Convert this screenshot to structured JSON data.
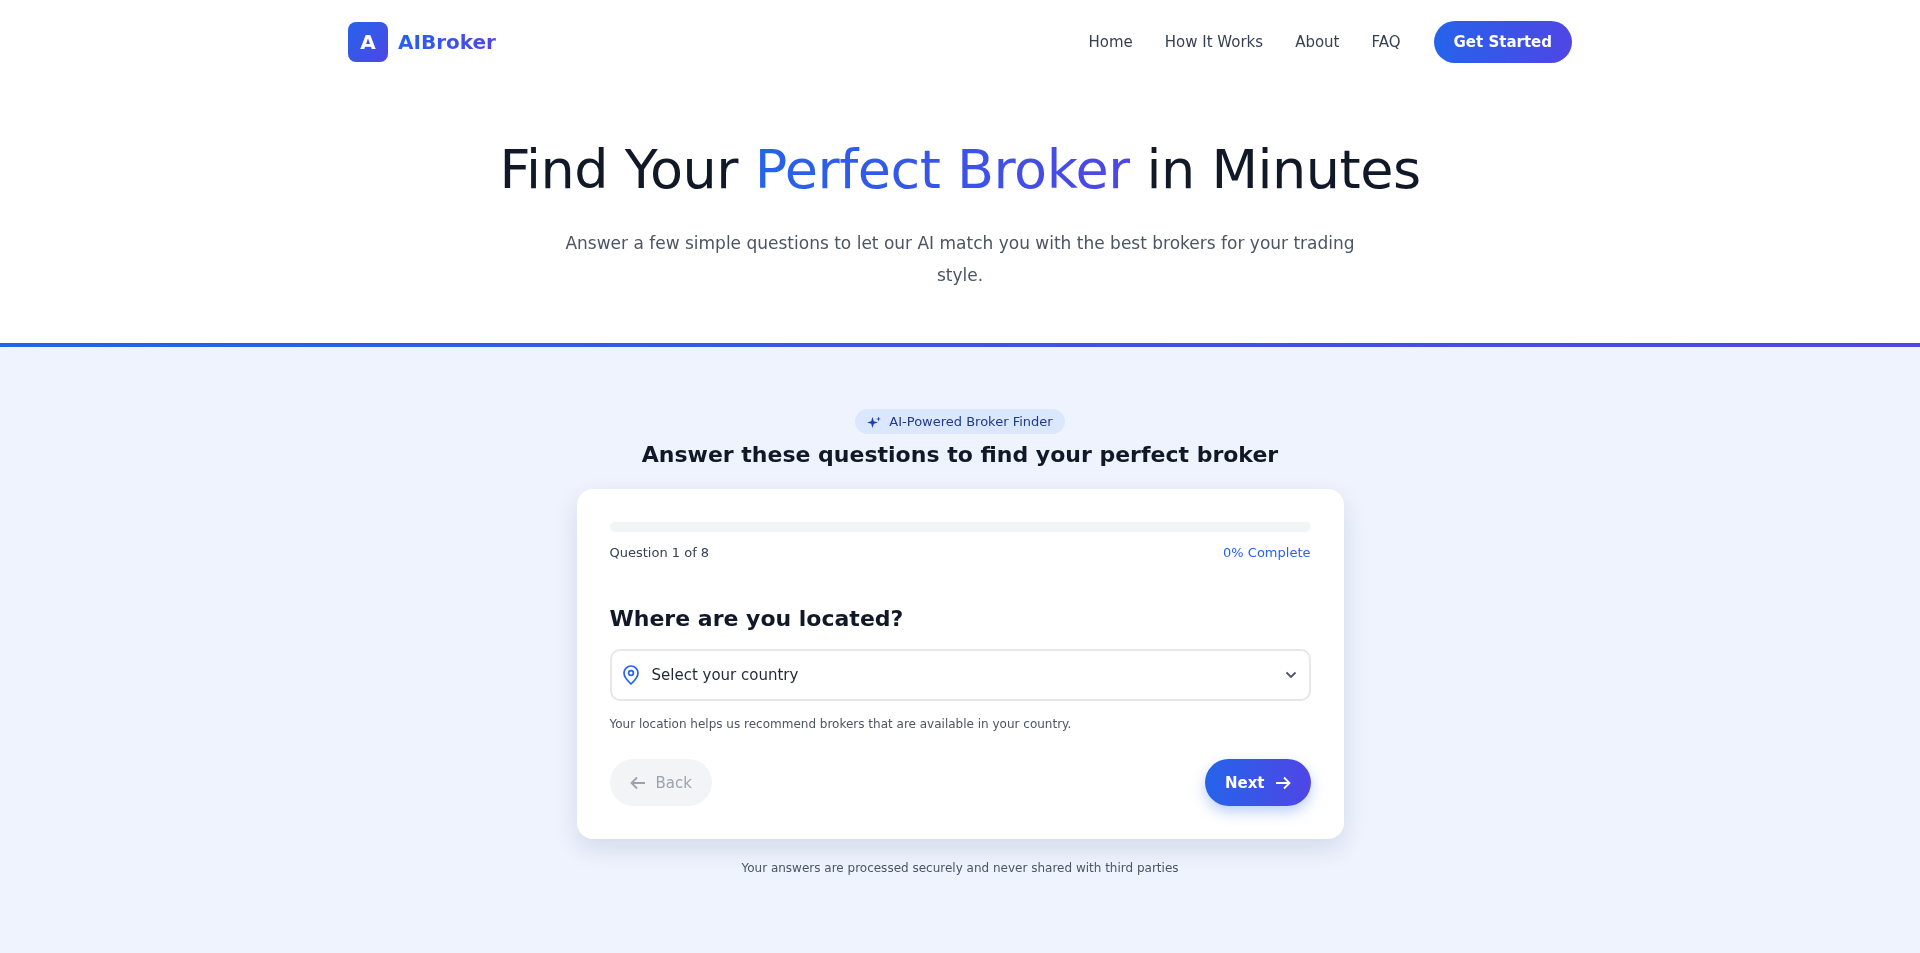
{
  "header": {
    "logo_letter": "A",
    "brand": "AIBroker",
    "nav": [
      {
        "label": "Home"
      },
      {
        "label": "How It Works"
      },
      {
        "label": "About"
      },
      {
        "label": "FAQ"
      }
    ],
    "cta": "Get Started"
  },
  "hero": {
    "title": "Find Your **Perfect Broker** in Minutes",
    "subtitle": "Answer a few simple questions to let our AI match you with the best brokers for your trading style."
  },
  "quiz": {
    "badge": "AI-Powered Broker Finder",
    "heading": "Answer these questions to find your perfect broker",
    "progress": {
      "level": 0,
      "step": "Question 1 of 8",
      "complete": "0% Complete"
    },
    "question": "Where are you located?",
    "country_select": {
      "placeholder": "Select your country"
    },
    "help": "Your location helps us recommend brokers that are available in your country.",
    "back": {
      "label": "Back",
      "disabled": true
    },
    "next": {
      "label": "Next",
      "disabled": false
    },
    "footnote": "Your answers are processed securely and never shared with third parties"
  }
}
